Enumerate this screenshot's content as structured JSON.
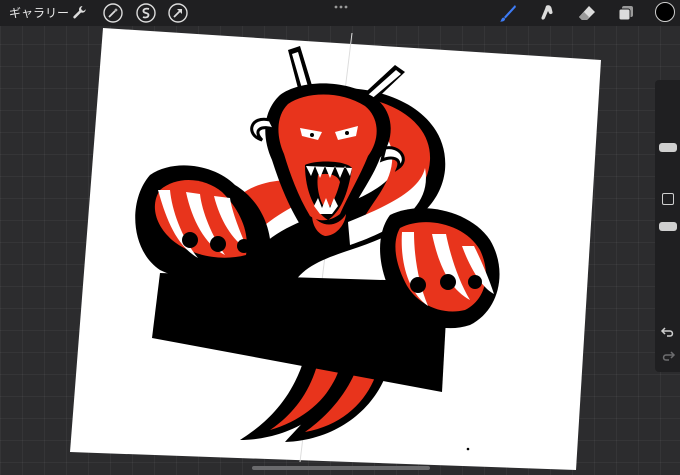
{
  "topbar": {
    "gallery_label": "ギャラリー",
    "tools_left": [
      "wrench-icon",
      "magic-wand-icon",
      "selection-icon",
      "transform-icon"
    ],
    "tools_right": [
      "brush-icon",
      "smudge-icon",
      "eraser-icon",
      "layers-icon"
    ],
    "active_tool": "brush-icon",
    "active_color": "#000000",
    "accent_color": "#3d7bf5"
  },
  "sidebar": {
    "buttons": [
      "brush-size-slider",
      "modify-button",
      "opacity-slider",
      "undo-icon",
      "redo-icon"
    ]
  },
  "artwork": {
    "colors": [
      "#000000",
      "#e8341c",
      "#ffffff"
    ]
  }
}
